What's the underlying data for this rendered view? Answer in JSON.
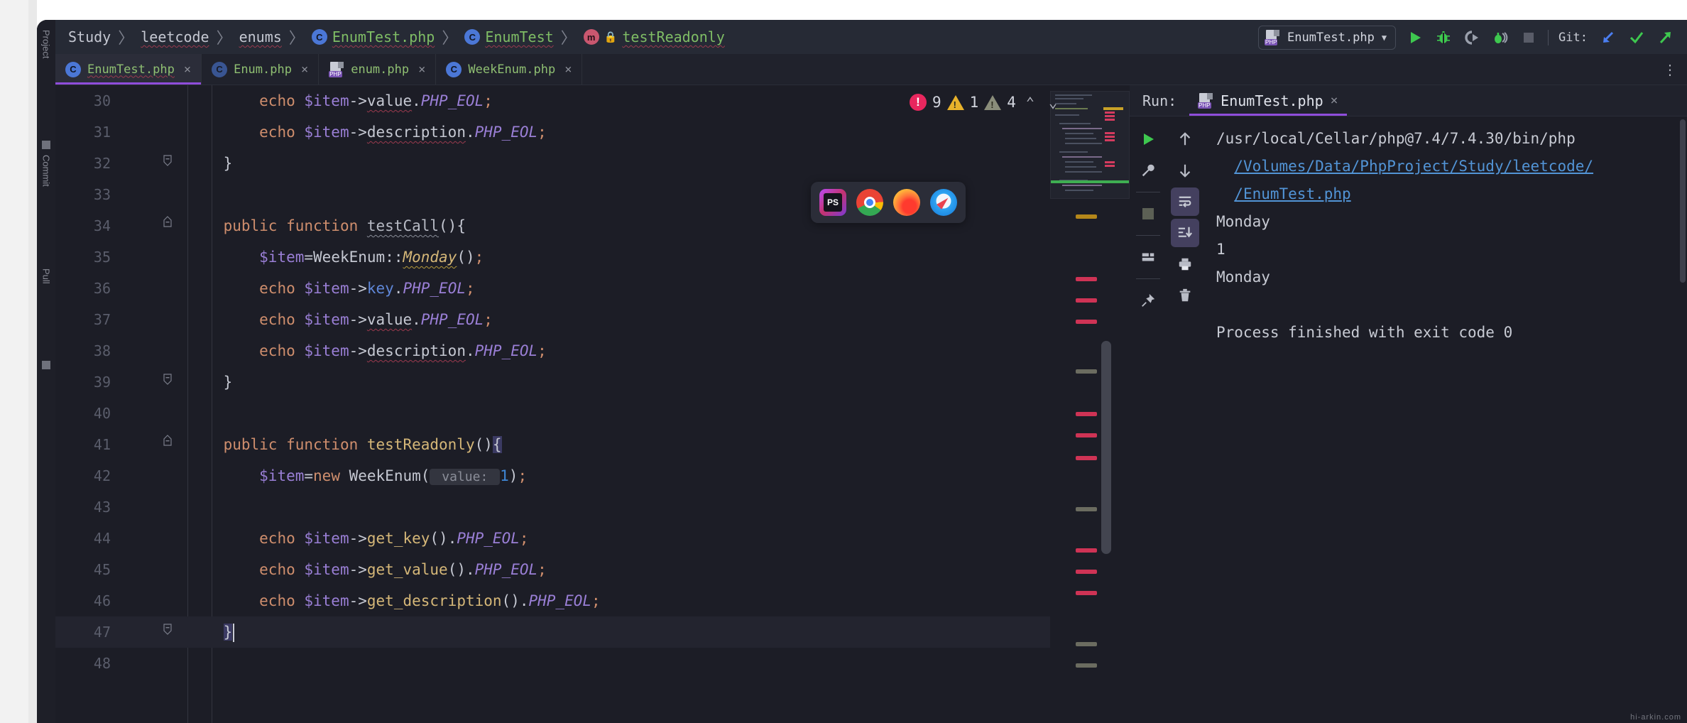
{
  "breadcrumb": {
    "items": [
      {
        "label": "Study",
        "icon": "",
        "style": "plain"
      },
      {
        "label": "leetcode",
        "icon": "",
        "style": "plain-squiggle"
      },
      {
        "label": "enums",
        "icon": "",
        "style": "plain-squiggle"
      },
      {
        "label": "EnumTest.php",
        "icon": "class-badge-c",
        "style": "green-squiggle"
      },
      {
        "label": "EnumTest",
        "icon": "class-badge-c",
        "style": "green-squiggle"
      },
      {
        "label": "testReadonly",
        "icon": "method-badge-m",
        "lock": "lock-icon",
        "style": "green-squiggle"
      }
    ],
    "separator": "〉"
  },
  "toolbar": {
    "run_config_label": "EnumTest.php",
    "run_config_icon": "php-file-icon",
    "dropdown_caret": "▼",
    "buttons": [
      {
        "name": "run-button",
        "icon": "play-icon",
        "color": "#4caf50"
      },
      {
        "name": "debug-button",
        "icon": "bug-icon",
        "color": "#4caf50"
      },
      {
        "name": "run-with-coverage-button",
        "icon": "coverage-icon",
        "color": "#9aa0ac"
      },
      {
        "name": "profile-button",
        "icon": "profile-bug-icon",
        "color": "#4caf50"
      },
      {
        "name": "stop-button",
        "icon": "stop-square-icon",
        "color": "#595c68"
      }
    ],
    "git_label": "Git:",
    "git_buttons": [
      {
        "name": "git-update-button",
        "icon": "arrow-down-left-icon",
        "color": "#4b7ef0"
      },
      {
        "name": "git-commit-button",
        "icon": "check-icon",
        "color": "#4caf50"
      },
      {
        "name": "git-push-button",
        "icon": "arrow-up-right-icon",
        "color": "#4caf50"
      }
    ]
  },
  "tabs": [
    {
      "label": "EnumTest.php",
      "icon": "class-badge-c",
      "active": true,
      "close": "×"
    },
    {
      "label": "Enum.php",
      "icon": "class-badge-c-dim",
      "active": false,
      "close": "×"
    },
    {
      "label": "enum.php",
      "icon": "php-file-icon",
      "active": false,
      "close": "×"
    },
    {
      "label": "WeekEnum.php",
      "icon": "class-badge-c",
      "active": false,
      "close": "×"
    }
  ],
  "tab_overflow_icon": "⋮",
  "inspection": {
    "errors": "9",
    "warnings": "1",
    "weak_warnings": "4",
    "prev_icon": "⌃",
    "next_icon": "⌄"
  },
  "dock": {
    "apps": [
      {
        "name": "phpstorm-icon",
        "label": "PS"
      },
      {
        "name": "chrome-icon",
        "label": ""
      },
      {
        "name": "firefox-icon",
        "label": ""
      },
      {
        "name": "safari-icon",
        "label": ""
      }
    ]
  },
  "editor": {
    "lines": [
      {
        "num": "30",
        "fold": "",
        "indent": 2,
        "tokens": [
          {
            "t": "echo ",
            "c": "t-echo"
          },
          {
            "t": "$item",
            "c": "t-var"
          },
          {
            "t": "->",
            "c": "t-punc"
          },
          {
            "t": "value",
            "c": "t-prop squigr"
          },
          {
            "t": ".",
            "c": "t-punc"
          },
          {
            "t": "PHP_EOL",
            "c": "t-const"
          },
          {
            "t": ";",
            "c": "t-semi"
          }
        ]
      },
      {
        "num": "31",
        "fold": "",
        "indent": 2,
        "tokens": [
          {
            "t": "echo ",
            "c": "t-echo"
          },
          {
            "t": "$item",
            "c": "t-var"
          },
          {
            "t": "->",
            "c": "t-punc"
          },
          {
            "t": "description",
            "c": "t-prop squigr"
          },
          {
            "t": ".",
            "c": "t-punc"
          },
          {
            "t": "PHP_EOL",
            "c": "t-const"
          },
          {
            "t": ";",
            "c": "t-semi"
          }
        ]
      },
      {
        "num": "32",
        "fold": "fold-end",
        "indent": 1,
        "tokens": [
          {
            "t": "}",
            "c": "t-punc"
          }
        ]
      },
      {
        "num": "33",
        "fold": "",
        "indent": 0,
        "tokens": []
      },
      {
        "num": "34",
        "fold": "fold-start",
        "indent": 1,
        "tokens": [
          {
            "t": "public function ",
            "c": "t-kw"
          },
          {
            "t": "testCall",
            "c": "t-fname squigw"
          },
          {
            "t": "(){",
            "c": "t-punc"
          }
        ]
      },
      {
        "num": "35",
        "fold": "",
        "indent": 2,
        "tokens": [
          {
            "t": "$item",
            "c": "t-var"
          },
          {
            "t": "=",
            "c": "t-punc"
          },
          {
            "t": "WeekEnum",
            "c": "t-classnm"
          },
          {
            "t": "::",
            "c": "t-punc"
          },
          {
            "t": "Monday",
            "c": "t-methodi squigy"
          },
          {
            "t": "()",
            "c": "t-punc"
          },
          {
            "t": ";",
            "c": "t-semi"
          }
        ]
      },
      {
        "num": "36",
        "fold": "",
        "indent": 2,
        "tokens": [
          {
            "t": "echo ",
            "c": "t-echo"
          },
          {
            "t": "$item",
            "c": "t-var"
          },
          {
            "t": "->",
            "c": "t-punc"
          },
          {
            "t": "key",
            "c": "t-propblue"
          },
          {
            "t": ".",
            "c": "t-punc"
          },
          {
            "t": "PHP_EOL",
            "c": "t-const"
          },
          {
            "t": ";",
            "c": "t-semi"
          }
        ]
      },
      {
        "num": "37",
        "fold": "",
        "indent": 2,
        "tokens": [
          {
            "t": "echo ",
            "c": "t-echo"
          },
          {
            "t": "$item",
            "c": "t-var"
          },
          {
            "t": "->",
            "c": "t-punc"
          },
          {
            "t": "value",
            "c": "t-prop squigr"
          },
          {
            "t": ".",
            "c": "t-punc"
          },
          {
            "t": "PHP_EOL",
            "c": "t-const"
          },
          {
            "t": ";",
            "c": "t-semi"
          }
        ]
      },
      {
        "num": "38",
        "fold": "",
        "indent": 2,
        "tokens": [
          {
            "t": "echo ",
            "c": "t-echo"
          },
          {
            "t": "$item",
            "c": "t-var"
          },
          {
            "t": "->",
            "c": "t-punc"
          },
          {
            "t": "description",
            "c": "t-prop squigr"
          },
          {
            "t": ".",
            "c": "t-punc"
          },
          {
            "t": "PHP_EOL",
            "c": "t-const"
          },
          {
            "t": ";",
            "c": "t-semi"
          }
        ]
      },
      {
        "num": "39",
        "fold": "fold-end",
        "indent": 1,
        "tokens": [
          {
            "t": "}",
            "c": "t-punc"
          }
        ]
      },
      {
        "num": "40",
        "fold": "",
        "indent": 0,
        "tokens": []
      },
      {
        "num": "41",
        "fold": "fold-start",
        "indent": 1,
        "tokens": [
          {
            "t": "public function ",
            "c": "t-kw"
          },
          {
            "t": "testReadonly",
            "c": "t-method"
          },
          {
            "t": "()",
            "c": "t-punc"
          },
          {
            "t": "{",
            "c": "t-punc bracehl"
          }
        ]
      },
      {
        "num": "42",
        "fold": "",
        "indent": 2,
        "tokens": [
          {
            "t": "$item",
            "c": "t-var"
          },
          {
            "t": "=",
            "c": "t-punc"
          },
          {
            "t": "new ",
            "c": "t-kw"
          },
          {
            "t": "WeekEnum",
            "c": "t-classnm"
          },
          {
            "t": "(",
            "c": "t-punc"
          },
          {
            "t": " value: ",
            "c": "hint"
          },
          {
            "t": "1",
            "c": "t-num"
          },
          {
            "t": ")",
            "c": "t-punc"
          },
          {
            "t": ";",
            "c": "t-semi"
          }
        ]
      },
      {
        "num": "43",
        "fold": "",
        "indent": 0,
        "tokens": []
      },
      {
        "num": "44",
        "fold": "",
        "indent": 2,
        "tokens": [
          {
            "t": "echo ",
            "c": "t-echo"
          },
          {
            "t": "$item",
            "c": "t-var"
          },
          {
            "t": "->",
            "c": "t-punc"
          },
          {
            "t": "get_key",
            "c": "t-method"
          },
          {
            "t": "()",
            "c": "t-punc"
          },
          {
            "t": ".",
            "c": "t-punc"
          },
          {
            "t": "PHP_EOL",
            "c": "t-const"
          },
          {
            "t": ";",
            "c": "t-semi"
          }
        ]
      },
      {
        "num": "45",
        "fold": "",
        "indent": 2,
        "tokens": [
          {
            "t": "echo ",
            "c": "t-echo"
          },
          {
            "t": "$item",
            "c": "t-var"
          },
          {
            "t": "->",
            "c": "t-punc"
          },
          {
            "t": "get_value",
            "c": "t-method"
          },
          {
            "t": "()",
            "c": "t-punc"
          },
          {
            "t": ".",
            "c": "t-punc"
          },
          {
            "t": "PHP_EOL",
            "c": "t-const"
          },
          {
            "t": ";",
            "c": "t-semi"
          }
        ]
      },
      {
        "num": "46",
        "fold": "",
        "indent": 2,
        "tokens": [
          {
            "t": "echo ",
            "c": "t-echo"
          },
          {
            "t": "$item",
            "c": "t-var"
          },
          {
            "t": "->",
            "c": "t-punc"
          },
          {
            "t": "get_description",
            "c": "t-method"
          },
          {
            "t": "()",
            "c": "t-punc"
          },
          {
            "t": ".",
            "c": "t-punc"
          },
          {
            "t": "PHP_EOL",
            "c": "t-const"
          },
          {
            "t": ";",
            "c": "t-semi"
          }
        ]
      },
      {
        "num": "47",
        "fold": "fold-end",
        "indent": 1,
        "cursor": true,
        "tokens": [
          {
            "t": "}",
            "c": "t-punc bracehl"
          }
        ]
      },
      {
        "num": "48",
        "fold": "",
        "indent": 0,
        "tokens": []
      }
    ]
  },
  "run_panel": {
    "label": "Run:",
    "tab_title": "EnumTest.php",
    "tab_icon": "php-file-icon",
    "tab_close": "×",
    "left_tools": [
      {
        "name": "rerun-button",
        "icon": "play-icon"
      },
      {
        "name": "edit-configuration-button",
        "icon": "wrench-icon"
      },
      {
        "name": "stop-button",
        "icon": "stop-square-icon"
      },
      {
        "name": "layout-settings-button",
        "icon": "layout-icon"
      },
      {
        "name": "pin-tab-button",
        "icon": "pin-icon"
      }
    ],
    "right_tools": [
      {
        "name": "up-the-stack-button",
        "icon": "arrow-up-icon",
        "selected": false
      },
      {
        "name": "down-the-stack-button",
        "icon": "arrow-down-icon",
        "selected": false
      },
      {
        "name": "soft-wrap-button",
        "icon": "soft-wrap-icon",
        "selected": true
      },
      {
        "name": "scroll-to-end-button",
        "icon": "scroll-to-end-icon",
        "selected": true
      },
      {
        "name": "print-button",
        "icon": "printer-icon",
        "selected": false
      },
      {
        "name": "clear-all-button",
        "icon": "trash-icon",
        "selected": false
      }
    ],
    "output": {
      "command": "/usr/local/Cellar/php@7.4/7.4.30/bin/php",
      "script_path_line1": "/Volumes/Data/PhpProject/Study/leetcode/",
      "script_path_line2": "/EnumTest.php",
      "results": [
        "Monday",
        "1",
        "Monday",
        "",
        "Process finished with exit code 0"
      ]
    }
  },
  "watermark": "hi-arkin.com",
  "colors": {
    "accent": "#8f4ddb",
    "error": "#e8275e",
    "warning": "#e8b22b",
    "weak_warning": "#8a8d7a",
    "link": "#5294d6",
    "string_green": "#7fbd65",
    "editor_bg": "#1c1d26",
    "panel_bg": "#20222c"
  }
}
